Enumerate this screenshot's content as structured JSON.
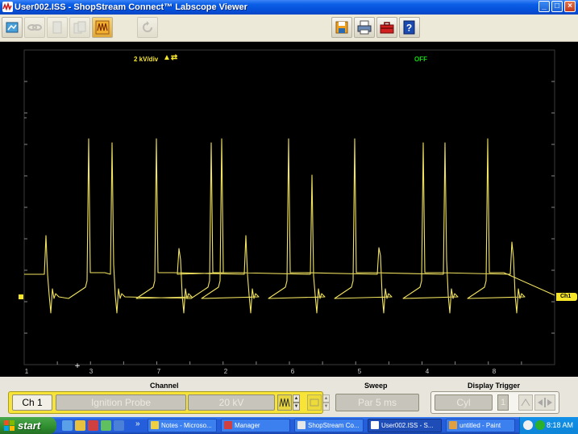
{
  "window": {
    "title": "User002.ISS - ShopStream Connect™ Labscope Viewer",
    "controls": [
      "_",
      "□",
      "×"
    ]
  },
  "toolbar": {
    "items": [
      {
        "name": "open-icon",
        "enabled": true
      },
      {
        "name": "link-icon",
        "enabled": false
      },
      {
        "name": "blank-page-icon",
        "enabled": false
      },
      {
        "name": "multi-page-icon",
        "enabled": false
      },
      {
        "name": "waveform-icon",
        "enabled": true
      },
      {
        "name": "refresh-icon",
        "enabled": false
      },
      {
        "name": "save-icon",
        "enabled": true
      },
      {
        "name": "print-icon",
        "enabled": true
      },
      {
        "name": "toolbox-icon",
        "enabled": true
      },
      {
        "name": "help-icon",
        "enabled": true
      }
    ]
  },
  "scope": {
    "scale_label": "2 kV/div",
    "scale_icon": "▲⇄",
    "trigger_state": "OFF",
    "channel_marker": "Ch1",
    "cylinder_labels": [
      "1",
      "3",
      "7",
      "2",
      "6",
      "5",
      "4",
      "8"
    ],
    "colors": {
      "trace": "#f2e35f",
      "grid": "#3a3a3a",
      "background": "#000000"
    }
  },
  "controls": {
    "channel_title": "Channel",
    "channel_button": "Ch 1",
    "probe": "Ignition Probe",
    "scale": "20 kV",
    "sweep_title": "Sweep",
    "sweep": "Par 5 ms",
    "trigger_title": "Display Trigger",
    "trigger_mode": "Cyl",
    "trigger_cyl": "1"
  },
  "taskbar": {
    "start": "start",
    "tasks": [
      {
        "label": "Notes - Microso...",
        "active": false
      },
      {
        "label": "Manager",
        "active": false
      },
      {
        "label": "ShopStream Co...",
        "active": false
      },
      {
        "label": "User002.ISS - S...",
        "active": true
      },
      {
        "label": "untitled - Paint",
        "active": false
      }
    ],
    "overflow": "»",
    "clock": "8:18 AM"
  }
}
